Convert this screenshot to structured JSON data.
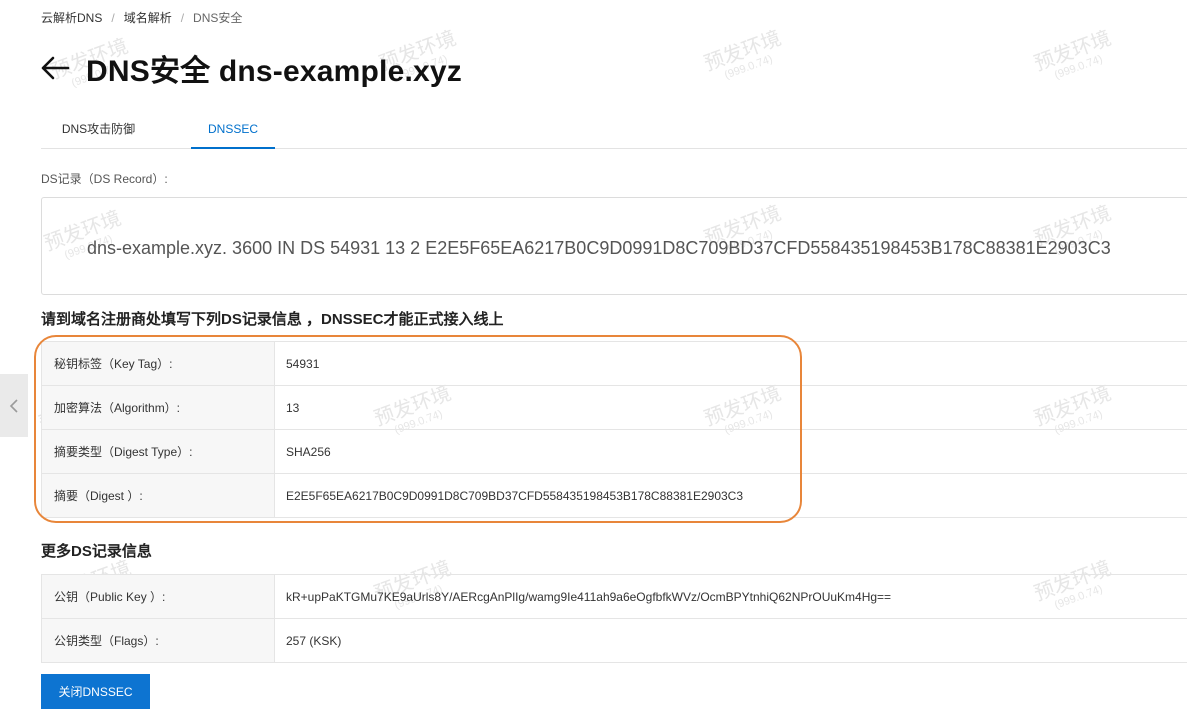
{
  "breadcrumb": {
    "items": [
      "云解析DNS",
      "域名解析",
      "DNS安全"
    ]
  },
  "header": {
    "title": "DNS安全 dns-example.xyz"
  },
  "tabs": [
    {
      "label": "DNS攻击防御",
      "active": false
    },
    {
      "label": "DNSSEC",
      "active": true
    }
  ],
  "ds_record": {
    "label": "DS记录（DS Record）:",
    "value": "dns-example.xyz. 3600 IN DS 54931 13 2 E2E5F65EA6217B0C9D0991D8C709BD37CFD558435198453B178C88381E2903C3"
  },
  "registrar_section": {
    "title": "请到域名注册商处填写下列DS记录信息 ，DNSSEC才能正式接入线上",
    "rows": [
      {
        "key": "秘钥标签（Key Tag）:",
        "value": "54931"
      },
      {
        "key": "加密算法（Algorithm）:",
        "value": "13"
      },
      {
        "key": "摘要类型（Digest Type）:",
        "value": "SHA256"
      },
      {
        "key": "摘要（Digest ）:",
        "value": "E2E5F65EA6217B0C9D0991D8C709BD37CFD558435198453B178C88381E2903C3"
      }
    ]
  },
  "more_section": {
    "title": "更多DS记录信息",
    "rows": [
      {
        "key": "公钥（Public Key ）:",
        "value": "kR+upPaKTGMu7KE9aUrls8Y/AERcgAnPlIg/wamg9Ie411ah9a6eOgfbfkWVz/OcmBPYtnhiQ62NPrOUuKm4Hg=="
      },
      {
        "key": "公钥类型（Flags）:",
        "value": "257 (KSK)"
      }
    ]
  },
  "actions": {
    "disable_label": "关闭DNSSEC"
  },
  "watermark": {
    "text": "预发环境",
    "version": "(999.0.74)"
  },
  "colors": {
    "accent": "#0070cc",
    "button": "#0d74d1",
    "highlight": "#e8863a"
  },
  "icons": {
    "back": "arrow-left-icon",
    "side_toggle": "chevron-left-icon"
  }
}
